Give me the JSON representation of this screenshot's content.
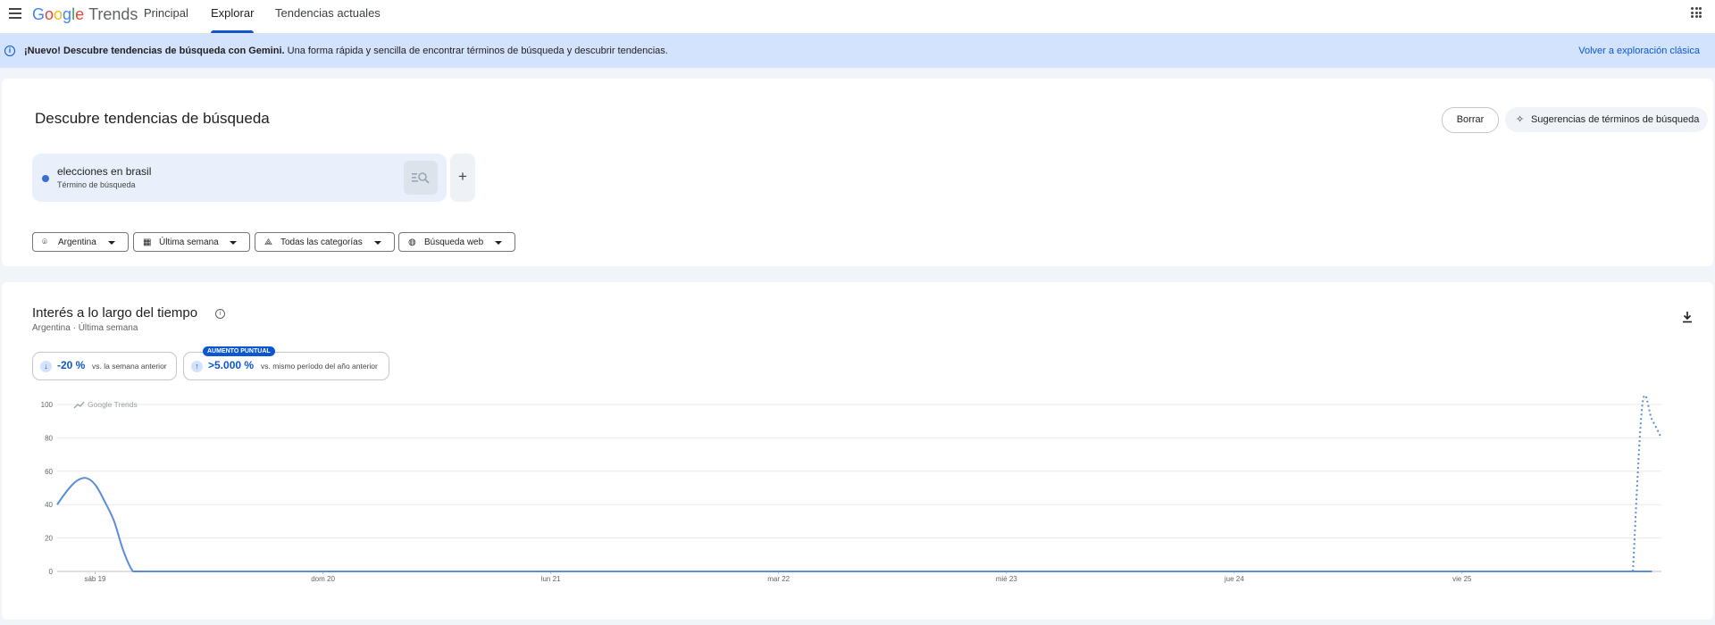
{
  "header": {
    "logo": {
      "google": [
        "G",
        "o",
        "o",
        "g",
        "l",
        "e"
      ],
      "trends": "Trends"
    },
    "tabs": [
      {
        "label": "Principal",
        "active": false
      },
      {
        "label": "Explorar",
        "active": true
      },
      {
        "label": "Tendencias actuales",
        "active": false
      }
    ]
  },
  "banner": {
    "bold_text": "¡Nuevo! Descubre tendencias de búsqueda con Gemini.",
    "text": " Una forma rápida y sencilla de encontrar términos de búsqueda y descubrir tendencias.",
    "link": "Volver a exploración clásica"
  },
  "discover": {
    "title": "Descubre tendencias de búsqueda",
    "clear_label": "Borrar",
    "suggest_label": "Sugerencias de términos de búsqueda",
    "term": {
      "name": "elecciones en brasil",
      "type": "Término de búsqueda",
      "color": "#3b6fd4"
    },
    "add_label": "+",
    "filters": [
      {
        "label": "Argentina",
        "icon": "location-pin-icon"
      },
      {
        "label": "Última semana",
        "icon": "calendar-icon"
      },
      {
        "label": "Todas las categorías",
        "icon": "category-icon"
      },
      {
        "label": "Búsqueda web",
        "icon": "globe-icon"
      }
    ]
  },
  "interest": {
    "title": "Interés a lo largo del tiempo",
    "subtitle_region": "Argentina",
    "subtitle_sep": " · ",
    "subtitle_period": "Última semana",
    "stats": [
      {
        "value": "-20 %",
        "desc": "vs. la semana anterior",
        "direction": "down"
      },
      {
        "value": ">5.000 %",
        "desc": "vs. mismo período del año anterior",
        "direction": "up",
        "badge": "AUMENTO PUNTUAL"
      }
    ],
    "watermark": "Google Trends"
  },
  "chart_data": {
    "type": "line",
    "y_ticks": [
      0,
      20,
      40,
      60,
      80,
      100
    ],
    "ylim": [
      0,
      100
    ],
    "x_labels": [
      "sáb 19",
      "dom 20",
      "lun 21",
      "mar 22",
      "mié 23",
      "jue 24",
      "vie 25"
    ],
    "x_label_index": [
      4,
      28,
      52,
      76,
      100,
      124,
      148
    ],
    "series": [
      {
        "color": "#5b8dd9",
        "values": [
          40,
          48,
          54,
          56,
          52,
          42,
          30,
          12,
          0,
          0,
          0,
          0,
          0,
          0,
          0,
          0,
          0,
          0,
          0,
          0,
          0,
          0,
          0,
          0,
          0,
          0,
          0,
          0,
          0,
          0,
          0,
          0,
          0,
          0,
          0,
          0,
          0,
          0,
          0,
          0,
          0,
          0,
          0,
          0,
          0,
          0,
          0,
          0,
          0,
          0,
          0,
          0,
          0,
          0,
          0,
          0,
          0,
          0,
          0,
          0,
          0,
          0,
          0,
          0,
          0,
          0,
          0,
          0,
          0,
          0,
          0,
          0,
          0,
          0,
          0,
          0,
          0,
          0,
          0,
          0,
          0,
          0,
          0,
          0,
          0,
          0,
          0,
          0,
          0,
          0,
          0,
          0,
          0,
          0,
          0,
          0,
          0,
          0,
          0,
          0,
          0,
          0,
          0,
          0,
          0,
          0,
          0,
          0,
          0,
          0,
          0,
          0,
          0,
          0,
          0,
          0,
          0,
          0,
          0,
          0,
          0,
          0,
          0,
          0,
          0,
          0,
          0,
          0,
          0,
          0,
          0,
          0,
          0,
          0,
          0,
          0,
          0,
          0,
          0,
          0,
          0,
          0,
          0,
          0,
          0,
          0,
          0,
          0,
          0,
          0,
          0,
          0,
          0,
          0,
          0,
          0,
          0,
          0,
          0,
          0,
          0,
          0,
          0,
          0,
          0,
          0,
          0,
          0,
          0
        ],
        "partial_from": 167,
        "partial_values": [
          100,
          91,
          80
        ]
      }
    ]
  }
}
